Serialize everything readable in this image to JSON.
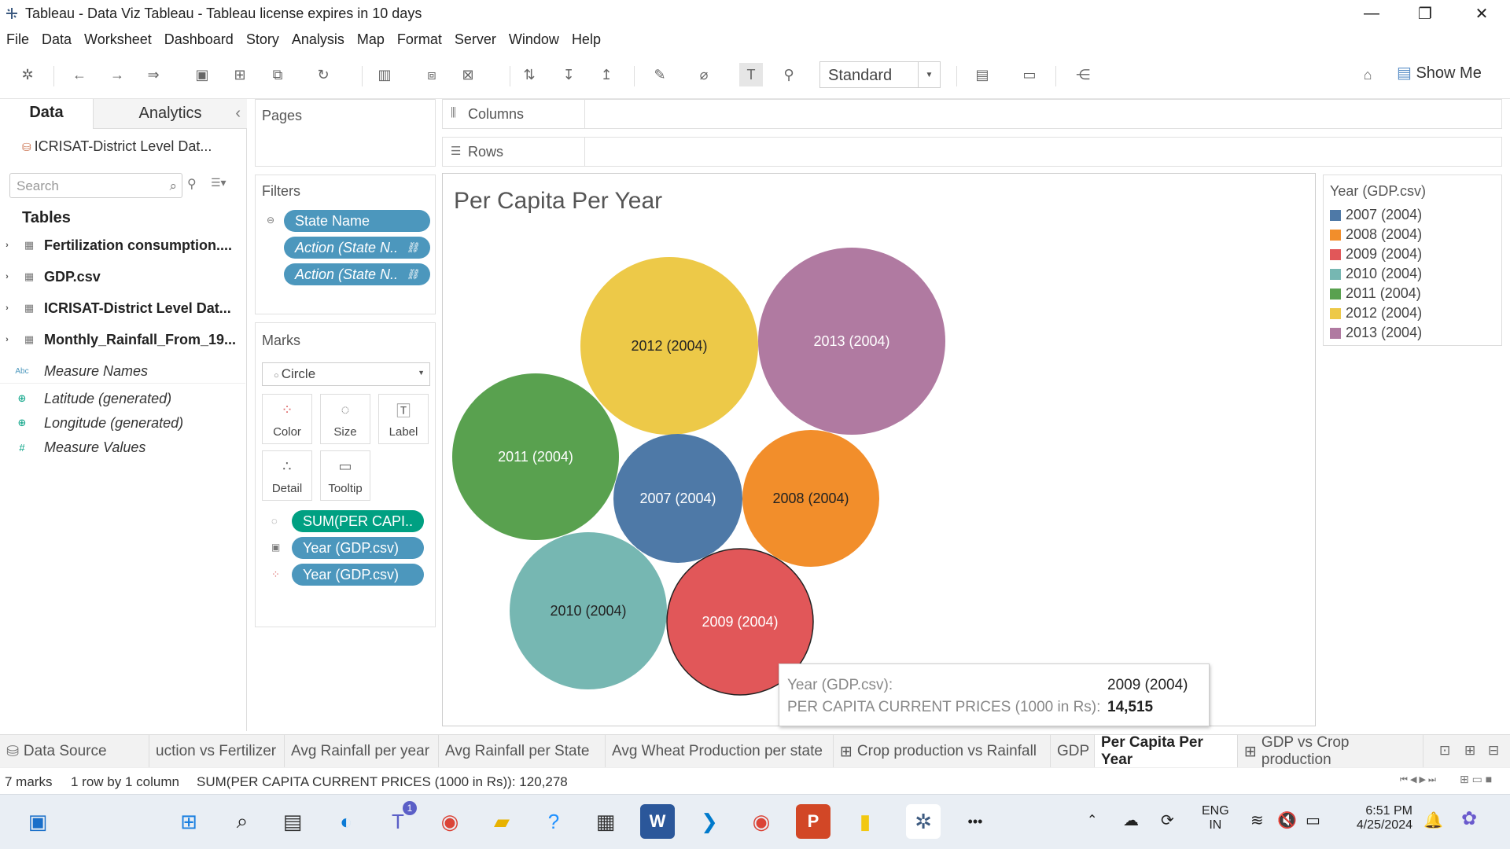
{
  "window": {
    "title": "Tableau - Data Viz Tableau - Tableau license expires in 10 days",
    "minimize": "—",
    "maximize": "❐",
    "close": "✕"
  },
  "menu": [
    "File",
    "Data",
    "Worksheet",
    "Dashboard",
    "Story",
    "Analysis",
    "Map",
    "Format",
    "Server",
    "Window",
    "Help"
  ],
  "toolbar": {
    "fit_select": "Standard",
    "show_me": "Show Me"
  },
  "datapane": {
    "tab_data": "Data",
    "tab_analytics": "Analytics",
    "collapse": "‹",
    "datasource": "ICRISAT-District Level Dat...",
    "search_placeholder": "Search",
    "tables_header": "Tables",
    "tables": [
      "Fertilization consumption....",
      "GDP.csv",
      "ICRISAT-District Level Dat...",
      "Monthly_Rainfall_From_19..."
    ],
    "fields": [
      {
        "icon": "Abc",
        "label": "Measure Names",
        "color": "#4c97bd"
      },
      {
        "icon": "⊕",
        "label": "Latitude (generated)",
        "color": "#00a082"
      },
      {
        "icon": "⊕",
        "label": "Longitude (generated)",
        "color": "#00a082"
      },
      {
        "icon": "#",
        "label": "Measure Values",
        "color": "#00a082"
      }
    ]
  },
  "pages": {
    "header": "Pages"
  },
  "filters": {
    "header": "Filters",
    "items": [
      "State Name",
      "Action (State N..",
      "Action (State N.."
    ]
  },
  "marks": {
    "header": "Marks",
    "type": "Circle",
    "buttons": [
      "Color",
      "Size",
      "Label",
      "Detail",
      "Tooltip"
    ],
    "pills": [
      "SUM(PER CAPI..",
      "Year (GDP.csv)",
      "Year (GDP.csv)"
    ]
  },
  "shelves": {
    "columns": "Columns",
    "rows": "Rows"
  },
  "view": {
    "title": "Per Capita Per Year"
  },
  "colors": {
    "2007": "#4e79a7",
    "2008": "#f28e2b",
    "2009": "#e15759",
    "2010": "#76b7b2",
    "2011": "#59a14f",
    "2012": "#edc948",
    "2013": "#b07aa1"
  },
  "chart_data": {
    "type": "bubble",
    "title": "Per Capita Per Year",
    "measure": "SUM(PER CAPITA CURRENT PRICES (1000 in Rs))",
    "total": 120278,
    "series": [
      {
        "name": "2012 (2004)",
        "color": "#edc948",
        "value": null
      },
      {
        "name": "2013 (2004)",
        "color": "#b07aa1",
        "value": null
      },
      {
        "name": "2011 (2004)",
        "color": "#59a14f",
        "value": null
      },
      {
        "name": "2007 (2004)",
        "color": "#4e79a7",
        "value": null
      },
      {
        "name": "2008 (2004)",
        "color": "#f28e2b",
        "value": null
      },
      {
        "name": "2010 (2004)",
        "color": "#76b7b2",
        "value": null
      },
      {
        "name": "2009 (2004)",
        "color": "#e15759",
        "value": 14515
      }
    ]
  },
  "legend": {
    "title": "Year (GDP.csv)",
    "items": [
      {
        "label": "2007 (2004)",
        "color": "#4e79a7"
      },
      {
        "label": "2008 (2004)",
        "color": "#f28e2b"
      },
      {
        "label": "2009 (2004)",
        "color": "#e15759"
      },
      {
        "label": "2010 (2004)",
        "color": "#76b7b2"
      },
      {
        "label": "2011 (2004)",
        "color": "#59a14f"
      },
      {
        "label": "2012 (2004)",
        "color": "#edc948"
      },
      {
        "label": "2013 (2004)",
        "color": "#b07aa1"
      }
    ]
  },
  "tooltip": {
    "k1": "Year (GDP.csv):",
    "v1": "2009 (2004)",
    "k2": "PER CAPITA CURRENT PRICES (1000 in Rs):",
    "v2": "14,515"
  },
  "sheettabs": [
    "Data Source",
    "uction vs Fertilizer",
    "Avg Rainfall per year",
    "Avg Rainfall per State",
    "Avg Wheat Production per state",
    "Crop production vs Rainfall",
    "GDP",
    "Per Capita Per Year",
    "GDP vs Crop production"
  ],
  "active_tab": "Per Capita Per Year",
  "status": {
    "marks": "7 marks",
    "dims": "1 row by 1 column",
    "sum": "SUM(PER CAPITA CURRENT PRICES (1000 in Rs)): 120,278"
  },
  "taskbar": {
    "lang1": "ENG",
    "lang2": "IN",
    "time": "6:51 PM",
    "date": "4/25/2024",
    "teams_badge": "1",
    "more": "•••"
  }
}
